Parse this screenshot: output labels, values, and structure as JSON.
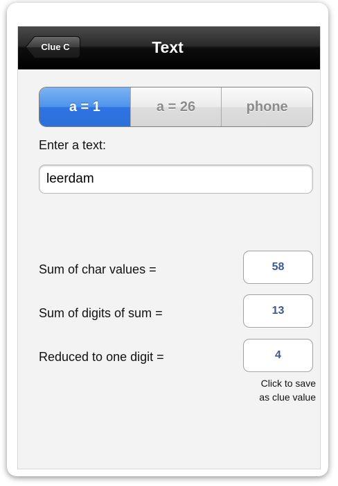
{
  "navbar": {
    "back_label": "Clue C",
    "title": "Text"
  },
  "segments": [
    {
      "label": "a = 1",
      "selected": true
    },
    {
      "label": "a = 26",
      "selected": false
    },
    {
      "label": "phone",
      "selected": false
    }
  ],
  "input": {
    "label": "Enter a text:",
    "value": "leerdam"
  },
  "results": [
    {
      "label": "Sum of char values =",
      "value": "58"
    },
    {
      "label": "Sum of digits of sum =",
      "value": "13"
    },
    {
      "label": "Reduced to one digit =",
      "value": "4"
    }
  ],
  "save_note": {
    "line1": "Click to save",
    "line2": "as clue value"
  },
  "colors": {
    "accent": "#2e74e3",
    "value_text": "#3c5a92",
    "navbar": "#000000",
    "background": "#f3f3f3"
  },
  "icons": {
    "back": "chevron-left-back-arrow"
  }
}
